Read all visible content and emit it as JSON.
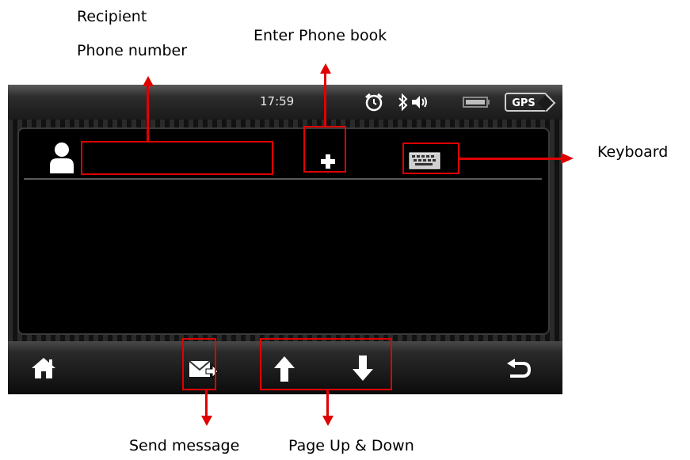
{
  "callouts": {
    "recipient_line1": "Recipient",
    "recipient_line2": "Phone number",
    "phonebook": "Enter Phone book",
    "keyboard": "Keyboard",
    "send": "Send message",
    "page": "Page Up & Down"
  },
  "statusbar": {
    "time": "17:59",
    "gps": "GPS",
    "icons": [
      "alarm-icon",
      "bluetooth-icon",
      "volume-icon",
      "battery-icon"
    ]
  },
  "compose": {
    "recipient_value": "",
    "icons": [
      "person-icon",
      "plus-icon",
      "keyboard-icon"
    ]
  },
  "bottombar": {
    "icons": [
      "home-icon",
      "send-message-icon",
      "page-up-icon",
      "page-down-icon",
      "back-icon"
    ]
  },
  "colors": {
    "annotation_red": "#e00000",
    "screen_bg": "#000000"
  }
}
